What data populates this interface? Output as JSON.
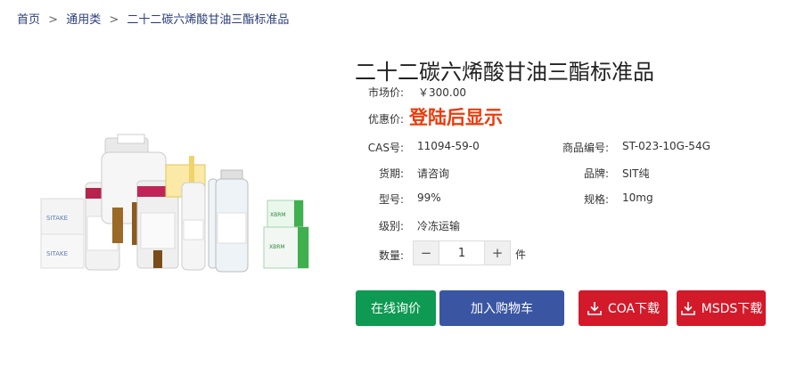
{
  "breadcrumb": {
    "home": "首页",
    "category": "通用类",
    "current": "二十二碳六烯酸甘油三酯标准品",
    "separator": ">"
  },
  "product": {
    "title": "二十二碳六烯酸甘油三酯标准品",
    "market_price_label": "市场价:",
    "market_price": "￥300.00",
    "promo_price_label": "优惠价:",
    "promo_price": "登陆后显示",
    "cas_label": "CAS号:",
    "cas": "11094-59-0",
    "product_code_label": "商品编号:",
    "product_code": "ST-023-10G-54G",
    "delivery_label": "货期:",
    "delivery": "请咨询",
    "brand_label": "品牌:",
    "brand": "SIT纯",
    "model_label": "型号:",
    "model": "99%",
    "spec_label": "规格:",
    "spec": "10mg",
    "grade_label": "级别:",
    "grade": "冷冻运输",
    "quantity_label": "数量:",
    "quantity": "1",
    "quantity_unit": "件",
    "minus": "−",
    "plus": "+"
  },
  "actions": {
    "inquiry": "在线询价",
    "add_to_cart": "加入购物车",
    "coa_download": "COA下载",
    "msds_download": "MSDS下载"
  },
  "colors": {
    "promo": "#ee3a0b",
    "inquiry_bg": "#0e9a52",
    "cart_bg": "#3a56a3",
    "download_bg": "#d21a2a",
    "breadcrumb": "#2b3e7a"
  },
  "image": {
    "brand_text_left": "SITAKE",
    "brand_text_right": "XBRM"
  }
}
